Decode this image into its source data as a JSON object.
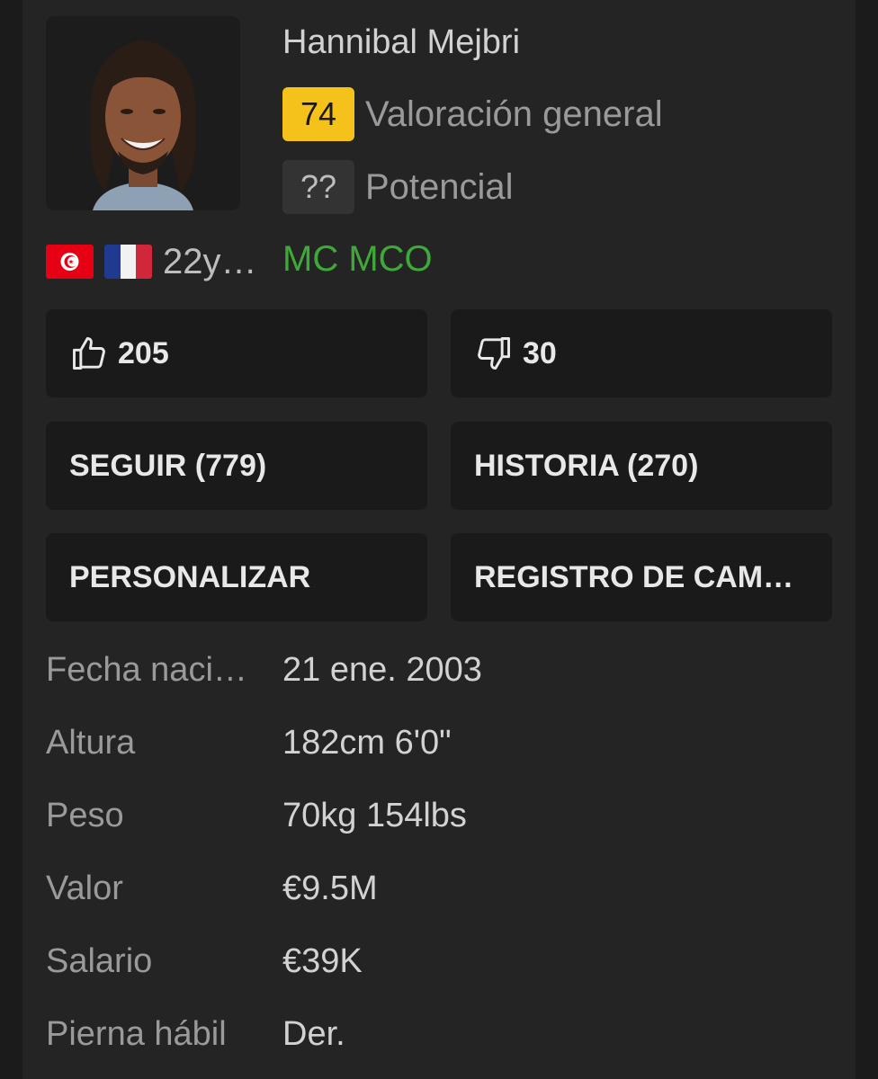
{
  "player": {
    "name": "Hannibal Mejbri",
    "overall": {
      "value": "74",
      "label": "Valoración general"
    },
    "potential": {
      "value": "??",
      "label": "Potencial"
    },
    "age": "22y…",
    "positions": "MC MCO",
    "flags": [
      "tunisia-flag",
      "france-flag"
    ]
  },
  "votes": {
    "likes": "205",
    "dislikes": "30"
  },
  "actions": {
    "follow": "SEGUIR (779)",
    "history": "HISTORIA (270)",
    "customize": "PERSONALIZAR",
    "changelog": "REGISTRO DE CAM…"
  },
  "info": {
    "birth": {
      "label": "Fecha naci…",
      "value": "21 ene. 2003"
    },
    "height": {
      "label": "Altura",
      "value": "182cm 6'0\""
    },
    "weight": {
      "label": "Peso",
      "value": "70kg 154lbs"
    },
    "value": {
      "label": "Valor",
      "value": "€9.5M"
    },
    "wage": {
      "label": "Salario",
      "value": "€39K"
    },
    "foot": {
      "label": "Pierna hábil",
      "value": "Der."
    }
  },
  "colors": {
    "overall_badge": "#f5c21b",
    "positions": "#3fa83a",
    "background": "#242424"
  }
}
